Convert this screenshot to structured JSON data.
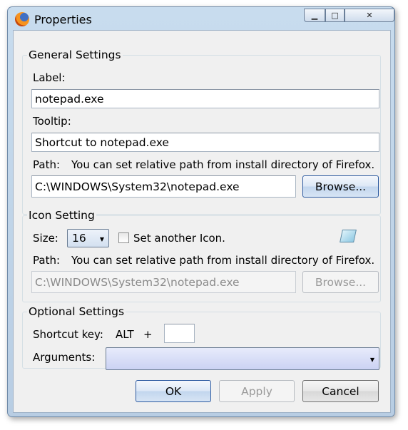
{
  "window": {
    "title": "Properties",
    "minimize_glyph": "▁",
    "maximize_glyph": "□",
    "close_glyph": "✕"
  },
  "general": {
    "heading": "General Settings",
    "label_caption": "Label:",
    "label_value": "notepad.exe",
    "tooltip_caption": "Tooltip:",
    "tooltip_value": "Shortcut to notepad.exe",
    "path_caption": "Path:",
    "path_hint": "You can set relative path from install directory of Firefox.",
    "path_value": "C:\\WINDOWS\\System32\\notepad.exe",
    "browse_label": "Browse..."
  },
  "icon": {
    "heading": "Icon Setting",
    "size_caption": "Size:",
    "size_value": "16",
    "set_another_label": "Set another Icon.",
    "set_another_checked": false,
    "path_caption": "Path:",
    "path_hint": "You can set relative path from install directory of Firefox.",
    "path_value": "C:\\WINDOWS\\System32\\notepad.exe",
    "browse_label": "Browse..."
  },
  "optional": {
    "heading": "Optional Settings",
    "shortcut_caption": "Shortcut key:",
    "modifier": "ALT",
    "plus": "+",
    "shortcut_value": "",
    "arguments_caption": "Arguments:",
    "arguments_value": ""
  },
  "buttons": {
    "ok": "OK",
    "apply": "Apply",
    "cancel": "Cancel"
  }
}
